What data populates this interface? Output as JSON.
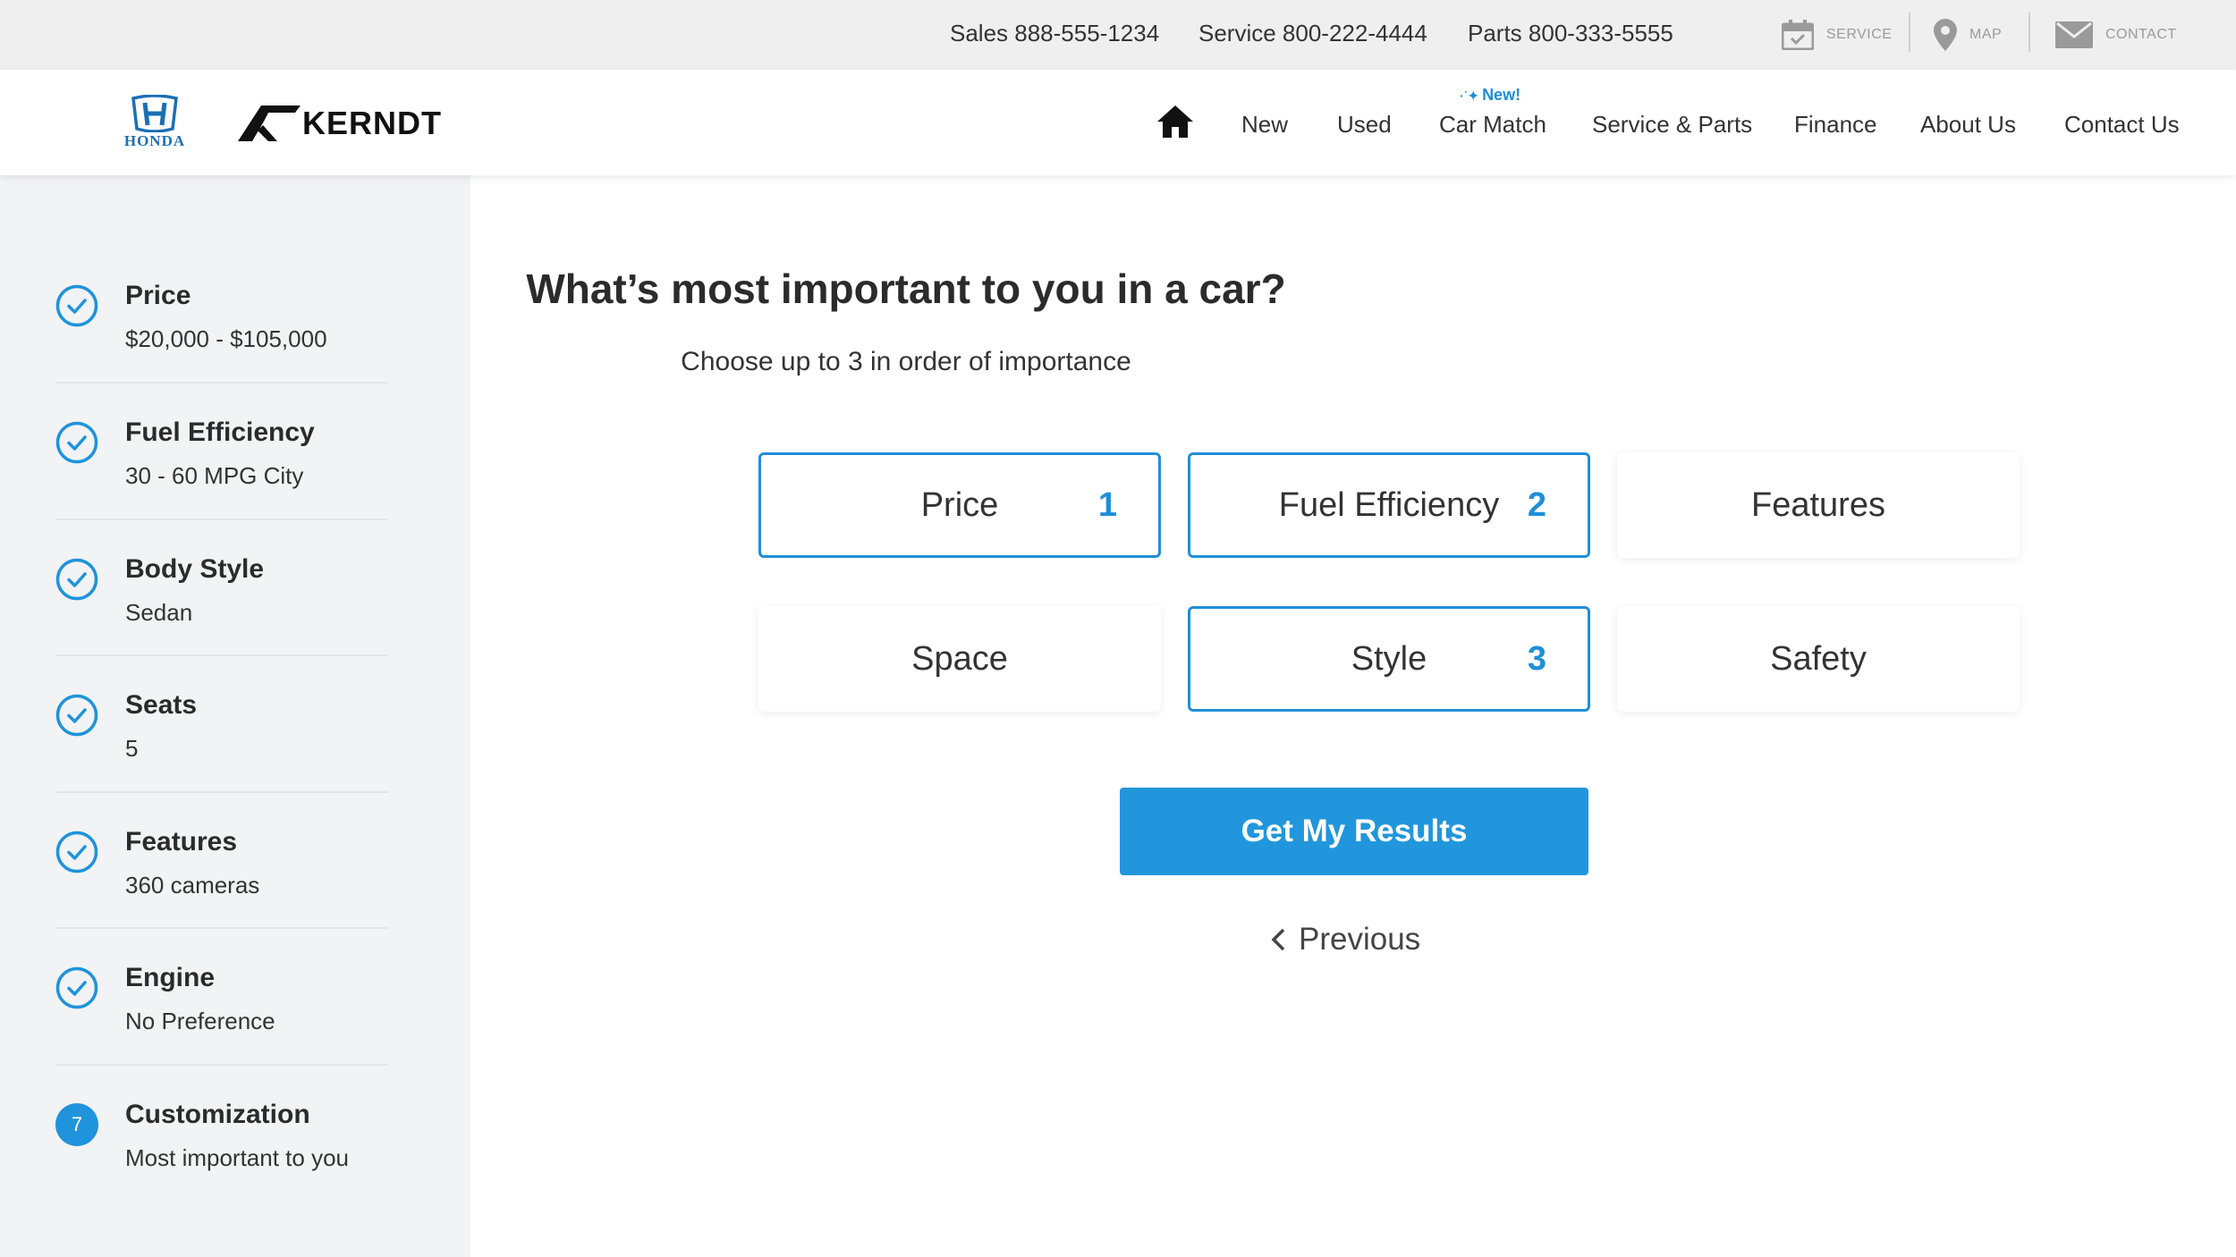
{
  "topbar": {
    "phones": [
      {
        "label": "Sales 888-555-1234"
      },
      {
        "label": "Service 800-222-4444"
      },
      {
        "label": "Parts 800-333-5555"
      }
    ],
    "links": [
      {
        "label": "SERVICE",
        "icon": "calendar-icon"
      },
      {
        "label": "MAP",
        "icon": "map-pin-icon"
      },
      {
        "label": "CONTACT",
        "icon": "envelope-icon"
      }
    ]
  },
  "header": {
    "logos": {
      "honda": "HONDA",
      "kerndt": "KERNDT"
    },
    "nav": [
      {
        "label": "New"
      },
      {
        "label": "Used"
      },
      {
        "label": "Car Match",
        "badge": "New!"
      },
      {
        "label": "Service & Parts"
      },
      {
        "label": "Finance"
      },
      {
        "label": "About Us"
      },
      {
        "label": "Contact Us"
      }
    ],
    "home_icon": "home-icon"
  },
  "sidebar": {
    "steps": [
      {
        "title": "Price",
        "value": "$20,000 - $105,000",
        "status": "complete"
      },
      {
        "title": "Fuel Efficiency",
        "value": "30 - 60 MPG City",
        "status": "complete"
      },
      {
        "title": "Body Style",
        "value": "Sedan",
        "status": "complete"
      },
      {
        "title": "Seats",
        "value": "5",
        "status": "complete"
      },
      {
        "title": "Features",
        "value": "360 cameras",
        "status": "complete"
      },
      {
        "title": "Engine",
        "value": "No Preference",
        "status": "complete"
      },
      {
        "title": "Customization",
        "value": "Most important to you",
        "status": "current",
        "number": "7"
      }
    ]
  },
  "main": {
    "title": "What’s most important to you in a car?",
    "subtitle": "Choose up to 3 in order of importance",
    "options": [
      {
        "label": "Price",
        "rank": "1"
      },
      {
        "label": "Fuel Efficiency",
        "rank": "2"
      },
      {
        "label": "Features",
        "rank": ""
      },
      {
        "label": "Space",
        "rank": ""
      },
      {
        "label": "Style",
        "rank": "3"
      },
      {
        "label": "Safety",
        "rank": ""
      }
    ],
    "cta_label": "Get My Results",
    "previous_label": "Previous"
  },
  "colors": {
    "accent": "#1f8fd8",
    "button": "#2196dc",
    "sidebar_bg": "#f2f3f5",
    "topbar_bg": "#efefef"
  }
}
